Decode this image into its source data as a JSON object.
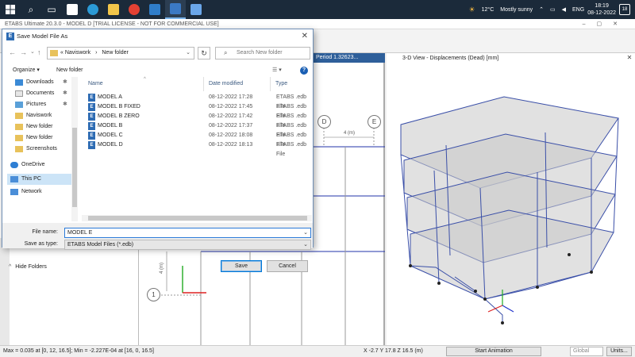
{
  "taskbar": {
    "tray": {
      "weather_temp": "12°C",
      "weather_text": "Mostly sunny",
      "lang": "ENG",
      "time": "18:19",
      "date": "08-12-2022",
      "notifications": "18"
    }
  },
  "app": {
    "title": "ETABS Ultimate 20.3.0 - MODEL D  [TRIAL LICENSE - NOT FOR COMMERCIAL USE]",
    "plan_tab": "Period 1.32623...",
    "view3d_tab": "3-D View  - Displacements (Dead)  [mm]",
    "grid_bubbles": [
      "D",
      "E",
      "1"
    ],
    "dim_label": "4 (m)",
    "dim_label_vert": "4 (m)"
  },
  "status": {
    "left": "Max = 0.035 at [0, 12, 16.5];  Min = -2.227E-04 at [16, 0, 16.5]",
    "coords": "X -2.7  Y 17.8  Z 16.5 (m)",
    "anim_button": "Start Animation",
    "coord_system": "Global",
    "units_button": "Units..."
  },
  "dialog": {
    "title": "Save Model File As",
    "breadcrumb": [
      "«  Naviswork",
      "›",
      "New folder"
    ],
    "search_placeholder": "Search New folder",
    "organize": "Organize ▾",
    "new_folder": "New folder",
    "nav_items": [
      {
        "label": "Downloads",
        "pinned": true
      },
      {
        "label": "Documents",
        "pinned": true
      },
      {
        "label": "Pictures",
        "pinned": true
      },
      {
        "label": "Naviswork",
        "pinned": false
      },
      {
        "label": "New folder",
        "pinned": false
      },
      {
        "label": "New folder",
        "pinned": false
      },
      {
        "label": "Screenshots",
        "pinned": false
      },
      {
        "label": "OneDrive",
        "pinned": false
      },
      {
        "label": "This PC",
        "pinned": false
      },
      {
        "label": "Network",
        "pinned": false
      }
    ],
    "columns": {
      "name": "Name",
      "date": "Date modified",
      "type": "Type"
    },
    "files": [
      {
        "name": "MODEL A",
        "date": "08-12-2022 17:28",
        "type": "ETABS .edb File"
      },
      {
        "name": "MODEL B FIXED",
        "date": "08-12-2022 17:45",
        "type": "ETABS .edb File"
      },
      {
        "name": "MODEL B ZERO",
        "date": "08-12-2022 17:42",
        "type": "ETABS .edb File"
      },
      {
        "name": "MODEL B",
        "date": "08-12-2022 17:37",
        "type": "ETABS .edb File"
      },
      {
        "name": "MODEL C",
        "date": "08-12-2022 18:08",
        "type": "ETABS .edb File"
      },
      {
        "name": "MODEL D",
        "date": "08-12-2022 18:13",
        "type": "ETABS .edb File"
      }
    ],
    "file_name_label": "File name:",
    "file_name_value": "MODEL E",
    "save_type_label": "Save as type:",
    "save_type_value": "ETABS Model Files (*.edb)",
    "hide_folders": "Hide Folders",
    "save_button": "Save",
    "cancel_button": "Cancel"
  }
}
